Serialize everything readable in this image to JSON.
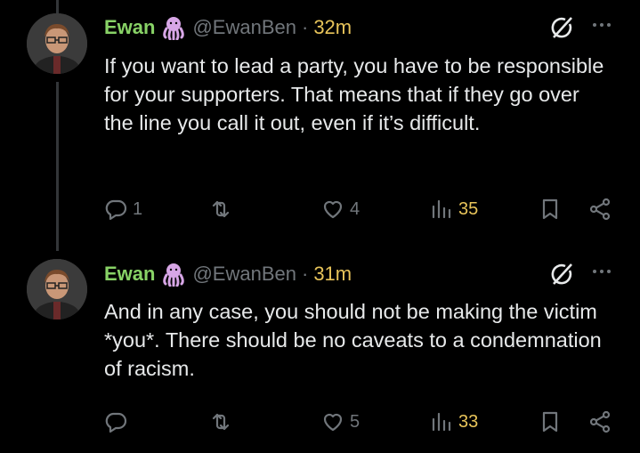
{
  "tweets": [
    {
      "name": "Ewan",
      "handle": "@EwanBen",
      "separator": "·",
      "time": "32m",
      "text": "If you want to lead a party, you have to be responsible for your supporters. That means that if they go over the line you call it out, even if it’s difficult.",
      "replies": "1",
      "retweets": "",
      "likes": "4",
      "views": "35"
    },
    {
      "name": "Ewan",
      "handle": "@EwanBen",
      "separator": "·",
      "time": "31m",
      "text": "And in any case, you should not be making the victim *you*. There should be no caveats to a condemnation of racism.",
      "replies": "",
      "retweets": "",
      "likes": "5",
      "views": "33"
    }
  ],
  "icons": {
    "badge": "octopus-icon",
    "grok": "grok-icon",
    "more": "more-icon",
    "reply": "reply-icon",
    "retweet": "retweet-icon",
    "like": "heart-icon",
    "views": "views-icon",
    "bookmark": "bookmark-icon",
    "share": "share-icon"
  },
  "colors": {
    "background": "#000000",
    "text": "#e7e9ea",
    "muted": "#71767b",
    "name": "#88d266",
    "accent_yellow": "#e8c45a",
    "badge": "#d7a6e6"
  }
}
